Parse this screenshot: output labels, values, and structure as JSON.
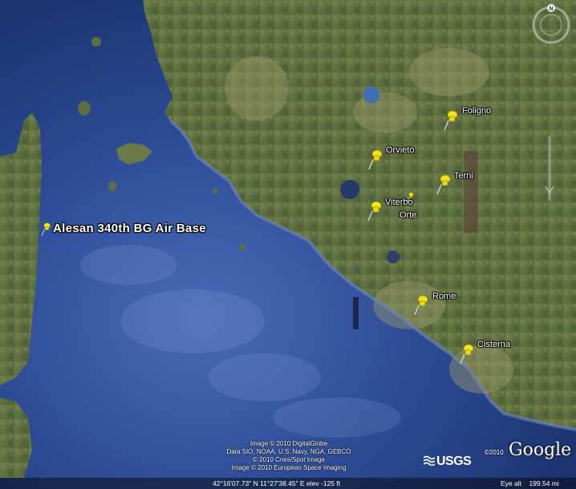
{
  "map": {
    "colors": {
      "sea_deep": "#1f3a78",
      "sea_shallow": "#3553a0",
      "land": "#5d6f3f",
      "land_light": "#8b8a60",
      "pin": "#f2e51c",
      "label_text": "#ffffff"
    },
    "placemarks": [
      {
        "label": "Alesan 340th BG Air Base",
        "icon": "yellow-pushpin-icon",
        "style": "large"
      },
      {
        "label": "Foligno",
        "icon": "yellow-pushpin-icon"
      },
      {
        "label": "Orvieto",
        "icon": "yellow-pushpin-icon"
      },
      {
        "label": "Terni",
        "icon": "yellow-pushpin-icon"
      },
      {
        "label": "Viterbo",
        "icon": "yellow-pushpin-icon"
      },
      {
        "label": "Orte",
        "icon": "yellow-pushpin-icon"
      },
      {
        "label": "Rome",
        "icon": "yellow-pushpin-icon"
      },
      {
        "label": "Cisterna",
        "icon": "yellow-pushpin-icon"
      }
    ],
    "compass_north_label": "N",
    "credits": [
      "Image © 2010 DigitalGlobe",
      "Data SIO, NOAA, U.S. Navy, NGA, GEBCO",
      "© 2010 Cnes/Spot Image",
      "Image © 2010 European Space Imaging"
    ],
    "usgs_label": "USGS",
    "google_year": "©2010",
    "google_logo": "Google",
    "status": {
      "coordinates": "42°16'07.73\" N   11°27'38.45\" E  elev  -125 ft",
      "eye_alt_label": "Eye alt",
      "eye_alt_value": "199.54 mi"
    }
  }
}
